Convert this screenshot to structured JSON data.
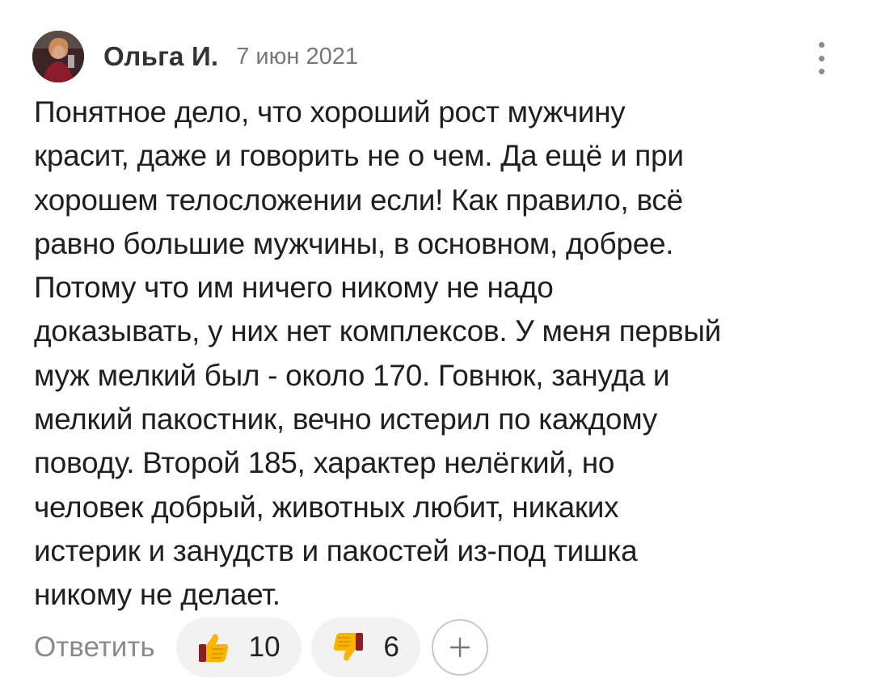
{
  "comment": {
    "author": "Ольга И.",
    "date": "7 июн 2021",
    "text": "Понятное дело, что хороший рост мужчину\nкрасит, даже и говорить не о чем. Да ещё и при\nхорошем телосложении если! Как правило, всё\nравно большие мужчины, в основном, добрее.\nПотому что им ничего никому не надо\nдоказывать, у них нет комплексов. У меня первый\nмуж мелкий был - около 170. Говнюк, зануда и\nмелкий пакостник, вечно истерил по каждому\nповоду. Второй 185, характер нелёгкий, но\nчеловек добрый, животных любит, никаких\nистерик и занудств и пакостей из-под тишка\nникому не делает."
  },
  "actions": {
    "reply_label": "Ответить",
    "like_count": "10",
    "dislike_count": "6",
    "like_icon": "thumbs-up-icon",
    "dislike_icon": "thumbs-down-icon",
    "add_icon": "plus-icon"
  },
  "colors": {
    "emoji_yellow": "#f7b500",
    "pill_background": "#f2f2f2",
    "muted_text": "#8b8b8b"
  }
}
